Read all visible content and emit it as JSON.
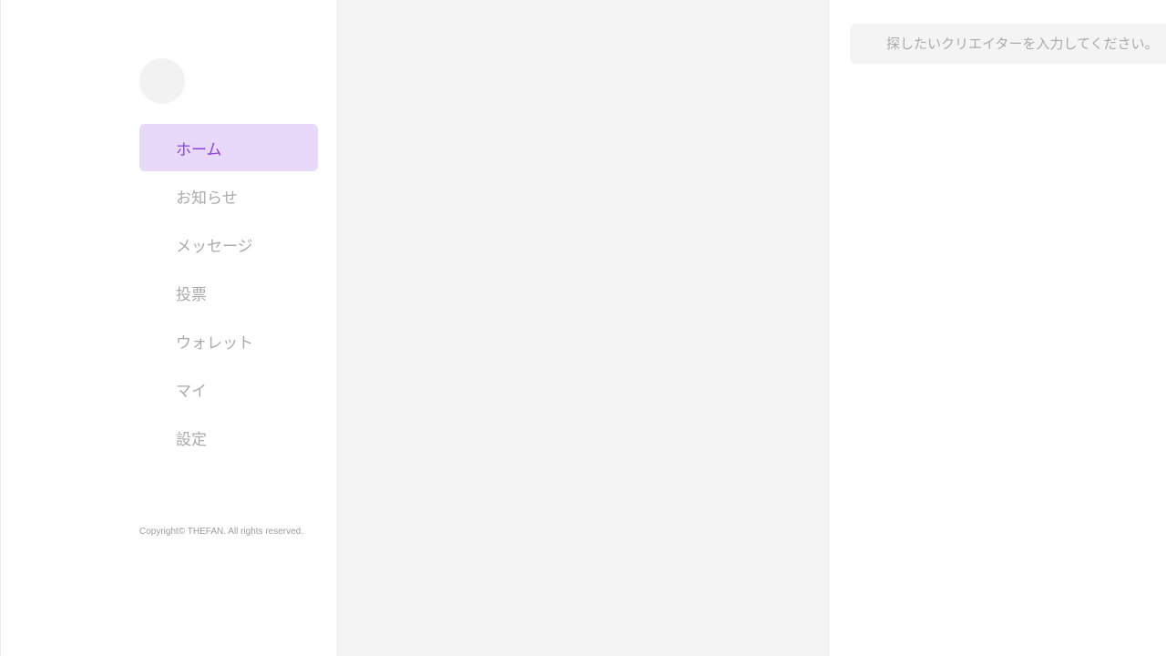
{
  "sidebar": {
    "nav": [
      {
        "label": "ホーム",
        "active": true
      },
      {
        "label": "お知らせ",
        "active": false
      },
      {
        "label": "メッセージ",
        "active": false
      },
      {
        "label": "投票",
        "active": false
      },
      {
        "label": "ウォレット",
        "active": false
      },
      {
        "label": "マイ",
        "active": false
      },
      {
        "label": "設定",
        "active": false
      }
    ],
    "copyright": "Copyright© THEFAN. All rights reserved."
  },
  "search": {
    "placeholder": "探したいクリエイターを入力してください。",
    "value": ""
  },
  "colors": {
    "accent": "#8e3fdf",
    "active_bg": "#e8d9fb",
    "muted_text": "#ababab",
    "panel_bg": "#f4f4f4"
  }
}
